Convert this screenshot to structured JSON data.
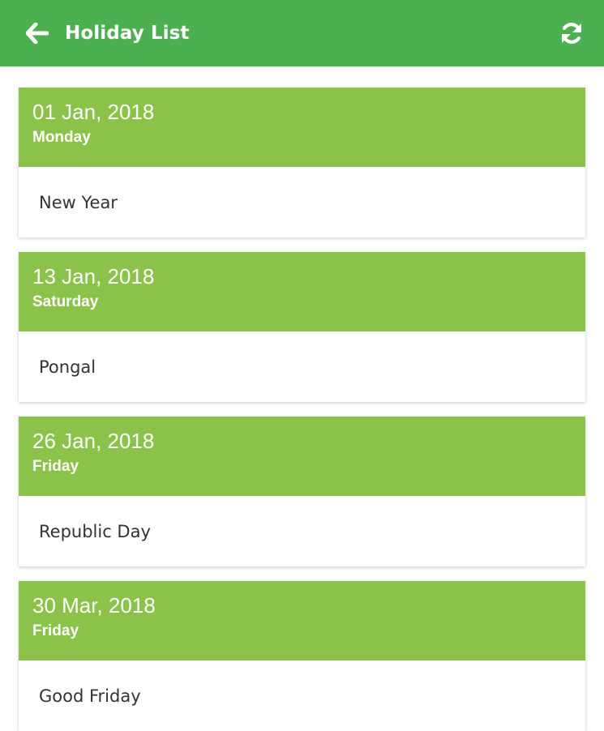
{
  "appbar": {
    "title": "Holiday List",
    "back_icon": "arrow-left-icon",
    "refresh_icon": "refresh-icon",
    "color": "#4caf50"
  },
  "holidays": [
    {
      "date": "01 Jan, 2018",
      "day": "Monday",
      "name": "New Year"
    },
    {
      "date": "13 Jan, 2018",
      "day": "Saturday",
      "name": "Pongal"
    },
    {
      "date": "26 Jan, 2018",
      "day": "Friday",
      "name": "Republic Day"
    },
    {
      "date": "30 Mar, 2018",
      "day": "Friday",
      "name": "Good Friday"
    }
  ],
  "colors": {
    "card_header": "#8bc34a",
    "card_text": "#333333"
  }
}
